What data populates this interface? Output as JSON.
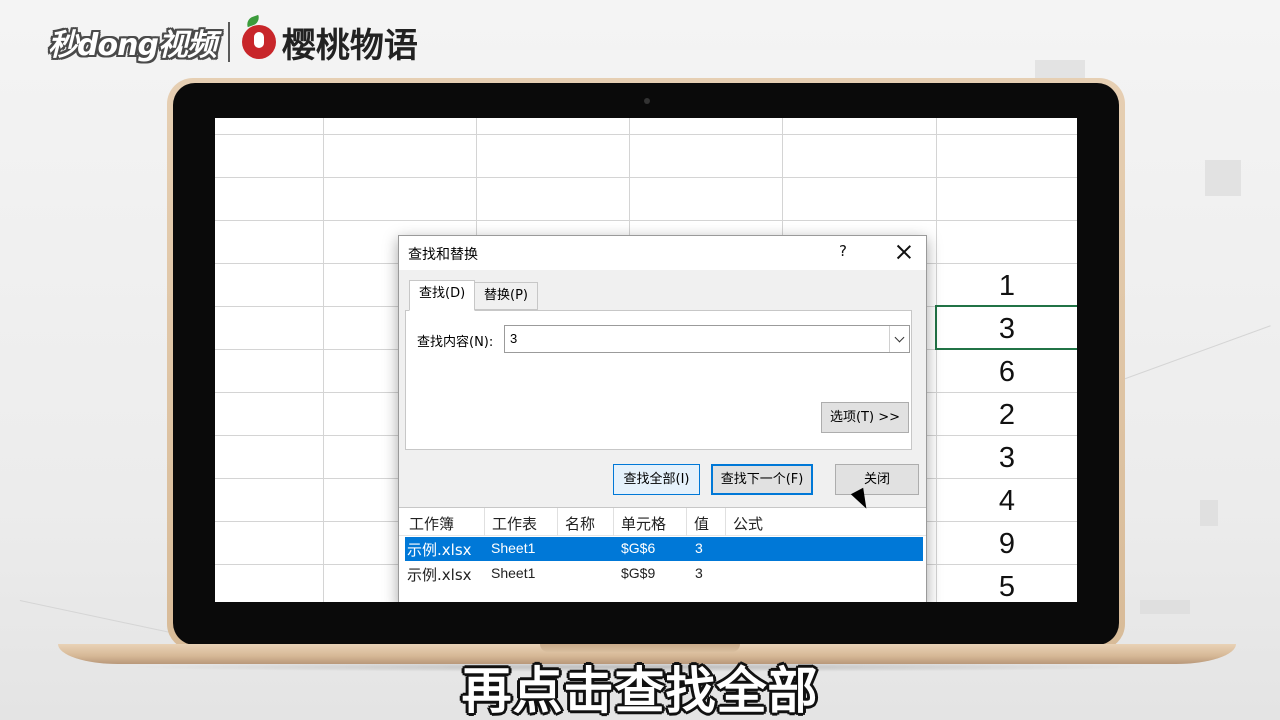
{
  "watermark": {
    "left": "秒dong视频",
    "right": "樱桃物语"
  },
  "cells": [
    "1",
    "3",
    "6",
    "2",
    "3",
    "4",
    "9",
    "5"
  ],
  "dialog": {
    "title": "查找和替换",
    "help": "?",
    "tabs": [
      {
        "label": "查找(D)"
      },
      {
        "label": "替换(P)"
      }
    ],
    "find_label": "查找内容(N):",
    "find_value": "3",
    "options_label": "选项(T) >>",
    "buttons": {
      "find_all": "查找全部(I)",
      "find_next": "查找下一个(F)",
      "close": "关闭"
    },
    "results": {
      "columns": [
        "工作簿",
        "工作表",
        "名称",
        "单元格",
        "值",
        "公式"
      ],
      "rows": [
        {
          "workbook": "示例.xlsx",
          "sheet": "Sheet1",
          "name": "",
          "cell": "$G$6",
          "value": "3",
          "formula": ""
        },
        {
          "workbook": "示例.xlsx",
          "sheet": "Sheet1",
          "name": "",
          "cell": "$G$9",
          "value": "3",
          "formula": ""
        }
      ]
    }
  },
  "subtitle": "再点击查找全部",
  "colors": {
    "accent": "#0078d7",
    "selection_border": "#217346",
    "laptop_gold": "#d8bb98"
  }
}
